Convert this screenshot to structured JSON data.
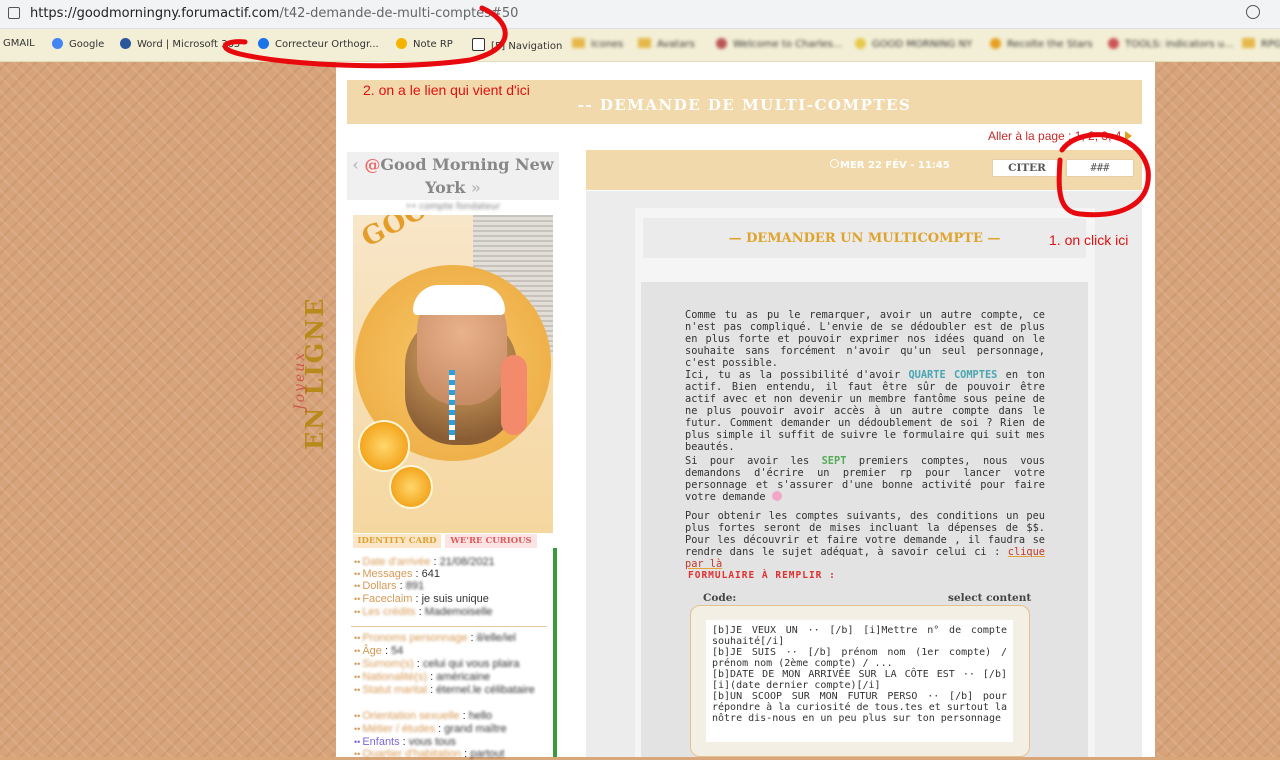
{
  "browser": {
    "url_prefix": "https://goodmorningny.forumactif.com",
    "url_path": "/t42-demande-de-multi-comptes#50"
  },
  "bookmarks": [
    {
      "label": "GMAIL",
      "color": "#d44"
    },
    {
      "label": "Google",
      "color": "#4285f4"
    },
    {
      "label": "Word | Microsoft 365",
      "color": "#2b579a"
    },
    {
      "label": "Correcteur Orthogr...",
      "color": "#1a73e8"
    },
    {
      "label": "Note RP",
      "color": "#f4b400"
    },
    {
      "label": "[5] Navigation",
      "color": "#333"
    },
    {
      "label": "Icones",
      "color": "#e6b84a"
    },
    {
      "label": "Avatars",
      "color": "#e6b84a"
    },
    {
      "label": "Welcome to Charles...",
      "color": "#b55"
    },
    {
      "label": "GOOD MORNING NY",
      "color": "#e6c84a"
    },
    {
      "label": "Recolte the Stars",
      "color": "#e6a020"
    },
    {
      "label": "TOOLS: indicators u...",
      "color": "#c55"
    },
    {
      "label": "RPG",
      "color": "#e6b84a"
    }
  ],
  "forum": {
    "topic_title": "-- DEMANDE DE MULTI-COMPTES",
    "goto_page": "Aller à la page : 1, 2, 3, 4",
    "online_label": "EN LIGNE",
    "online_script": "Joyeux",
    "profile": {
      "name_line1": "Good Morning New",
      "name_line2": "York",
      "rank": "•• compte fondateur",
      "tab_identity": "IDENTITY CARD",
      "tab_curious": "WE'RE CURIOUS",
      "stats": [
        {
          "key": "Date d'arrivée",
          "value": "21/08/2021"
        },
        {
          "key": "Messages",
          "value": "641"
        },
        {
          "key": "Dollars",
          "value": "891"
        },
        {
          "key": "Faceclaim",
          "value": "je suis unique"
        },
        {
          "key": "Les crédits",
          "value": "Mademoiselle"
        },
        {
          "key": "Pronoms personnage",
          "value": "il/elle/iel"
        },
        {
          "key": "Âge",
          "value": "54"
        },
        {
          "key": "Surnom(s)",
          "value": "celui qui vous plaira"
        },
        {
          "key": "Nationalité(s)",
          "value": "américaine"
        },
        {
          "key": "Statut marital",
          "value": "éternel.le célibataire"
        },
        {
          "key": "Orientation sexuelle",
          "value": "hello"
        },
        {
          "key": "Métier / études",
          "value": "grand maître"
        },
        {
          "key": "Enfants",
          "value": "vous tous"
        },
        {
          "key": "Quartier d'habitation",
          "value": "partout"
        }
      ]
    },
    "post": {
      "date": "MER 22 FÉV - 11:45",
      "quote_button": "CITER",
      "link_button": "###",
      "card_title": "— DEMANDER UN MULTICOMPTE —",
      "p1": "Comme tu as pu le remarquer, avoir un autre compte, ce n'est pas compliqué. L'envie de se dédoubler est de plus en plus forte et pouvoir exprimer nos idées quand on le souhaite sans forcément n'avoir qu'un seul personnage, c'est possible.",
      "p2_a": "Ici, tu as la possibilité d'avoir",
      "p2_hl": "QUARTE COMPTES",
      "p2_b": "en ton actif. Bien entendu, il faut être sûr de pouvoir être actif avec et non devenir un membre fantôme sous peine de ne plus pouvoir avoir accès à un autre compte dans le futur. Comment demander un dédoublement de soi ? Rien de plus simple il suffit de suivre le formulaire qui suit mes beautés.",
      "p3_a": "Si pour avoir les",
      "p3_hl": "SEPT",
      "p3_b": "premiers comptes, nous vous demandons d'écrire un premier rp pour lancer votre personnage et s'assurer d'une bonne activité pour faire votre demande",
      "p4_a": "Pour obtenir les comptes suivants, des conditions un peu plus fortes seront de mises incluant la dépenses de $$. Pour les découvrir et faire votre demande , il faudra se rendre dans le sujet adéquat, à savoir celui ci :",
      "p4_link": "clique par là",
      "form_title": "FORMULAIRE À REMPLIR :",
      "code_label": "Code:",
      "select_content": "select content",
      "code": "[b]JE VEUX UN ·· [/b] [i]Mettre n° de compte souhaité[/i]\n[b]JE SUIS ·· [/b] prénom nom (1er compte) / prénom nom (2ème compte) / ...\n[b]DATE DE MON ARRIVÉE SUR LA CÔTE EST ·· [/b] [i](date dernier compte)[/i]\n[b]UN SCOOP SUR MON FUTUR PERSO ·· [/b] pour répondre à la curiosité de tous.tes et surtout la nôtre dis-nous en un peu plus sur ton personnage"
    }
  },
  "annotations": {
    "note_link": "2. on a le lien qui vient d'ici",
    "note_click": "1. on click ici",
    "ink_color": "#e8090f"
  }
}
